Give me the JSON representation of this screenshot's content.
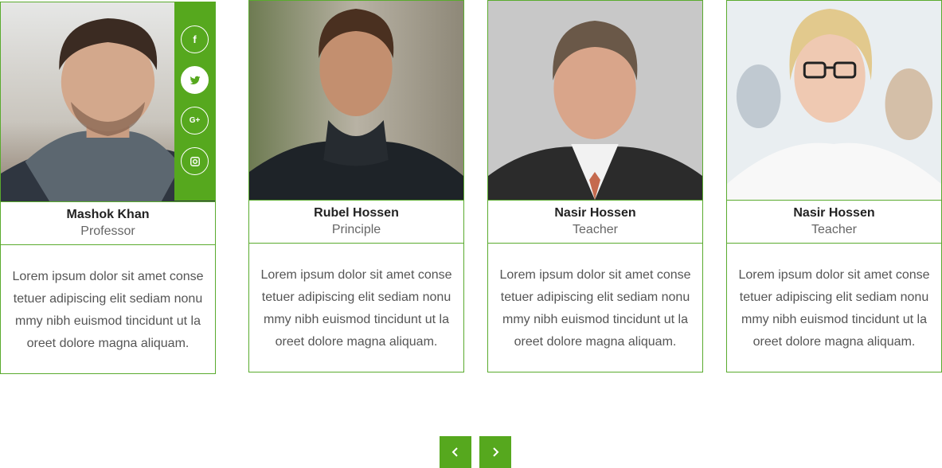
{
  "team": [
    {
      "name": "Mashok Khan",
      "role": "Professor",
      "bio": "Lorem ipsum dolor sit amet conse tetuer adipiscing elit sediam nonu mmy nibh euismod tincidunt ut la oreet dolore magna aliquam."
    },
    {
      "name": "Rubel Hossen",
      "role": "Principle",
      "bio": "Lorem ipsum dolor sit amet conse tetuer adipiscing elit sediam nonu mmy nibh euismod tincidunt ut la oreet dolore magna aliquam."
    },
    {
      "name": "Nasir Hossen",
      "role": "Teacher",
      "bio": "Lorem ipsum dolor sit amet conse tetuer adipiscing elit sediam nonu mmy nibh euismod tincidunt ut la oreet dolore magna aliquam."
    },
    {
      "name": "Nasir Hossen",
      "role": "Teacher",
      "bio": "Lorem ipsum dolor sit amet conse tetuer adipiscing elit sediam nonu mmy nibh euismod tincidunt ut la oreet dolore magna aliquam."
    }
  ],
  "social": {
    "icons": [
      "facebook-icon",
      "twitter-icon",
      "google-plus-icon",
      "instagram-icon"
    ],
    "facebook": "f",
    "googleplus": "G+"
  },
  "colors": {
    "accent": "#56a81e",
    "border": "#5aab2e"
  },
  "navigation": {
    "prev_icon": "chevron-left-icon",
    "next_icon": "chevron-right-icon"
  }
}
